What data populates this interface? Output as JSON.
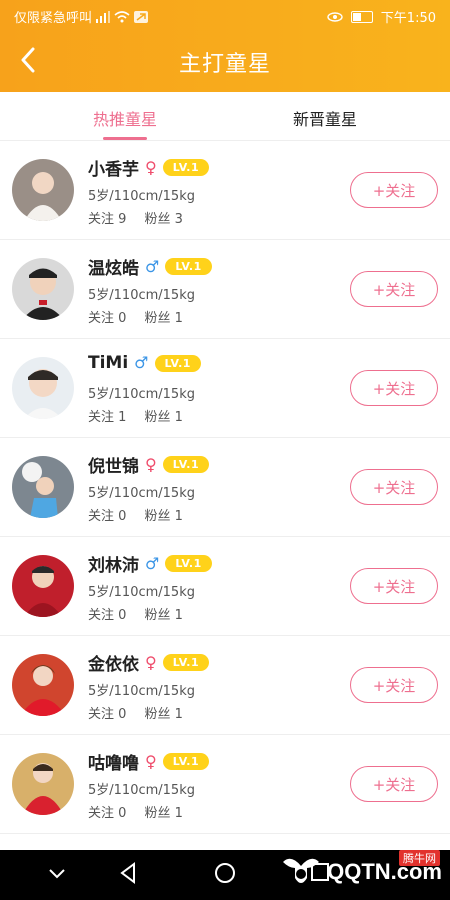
{
  "status_bar": {
    "carrier_text": "仅限紧急呼叫",
    "time": "下午1:50"
  },
  "header": {
    "title": "主打童星",
    "back_icon": "back-arrow-icon"
  },
  "tabs": [
    {
      "label": "热推童星",
      "active": true
    },
    {
      "label": "新晋童星",
      "active": false
    }
  ],
  "stars": [
    {
      "name": "小香芋",
      "gender": "female",
      "level": "LV.1",
      "info": "5岁/110cm/15kg",
      "follow_label": "关注",
      "follow_count": "9",
      "fans_label": "粉丝",
      "fans_count": "3",
      "button": "+关注"
    },
    {
      "name": "温炫皓",
      "gender": "male",
      "level": "LV.1",
      "info": "5岁/110cm/15kg",
      "follow_label": "关注",
      "follow_count": "0",
      "fans_label": "粉丝",
      "fans_count": "1",
      "button": "+关注"
    },
    {
      "name": "TiMi",
      "gender": "male",
      "level": "LV.1",
      "info": "5岁/110cm/15kg",
      "follow_label": "关注",
      "follow_count": "1",
      "fans_label": "粉丝",
      "fans_count": "1",
      "button": "+关注"
    },
    {
      "name": "倪世锦",
      "gender": "female",
      "level": "LV.1",
      "info": "5岁/110cm/15kg",
      "follow_label": "关注",
      "follow_count": "0",
      "fans_label": "粉丝",
      "fans_count": "1",
      "button": "+关注"
    },
    {
      "name": "刘林沛",
      "gender": "male",
      "level": "LV.1",
      "info": "5岁/110cm/15kg",
      "follow_label": "关注",
      "follow_count": "0",
      "fans_label": "粉丝",
      "fans_count": "1",
      "button": "+关注"
    },
    {
      "name": "金依依",
      "gender": "female",
      "level": "LV.1",
      "info": "5岁/110cm/15kg",
      "follow_label": "关注",
      "follow_count": "0",
      "fans_label": "粉丝",
      "fans_count": "1",
      "button": "+关注"
    },
    {
      "name": "咕噜噜",
      "gender": "female",
      "level": "LV.1",
      "info": "5岁/110cm/15kg",
      "follow_label": "关注",
      "follow_count": "0",
      "fans_label": "粉丝",
      "fans_count": "1",
      "button": "+关注"
    }
  ],
  "colors": {
    "header_orange": "#f8a91b",
    "accent_pink": "#ee6f8f",
    "level_badge": "#ffd21a",
    "female": "#ef4d6c",
    "male": "#3b95e6"
  },
  "watermark": {
    "logo": "QQTN.com",
    "tag": "腾牛网"
  }
}
